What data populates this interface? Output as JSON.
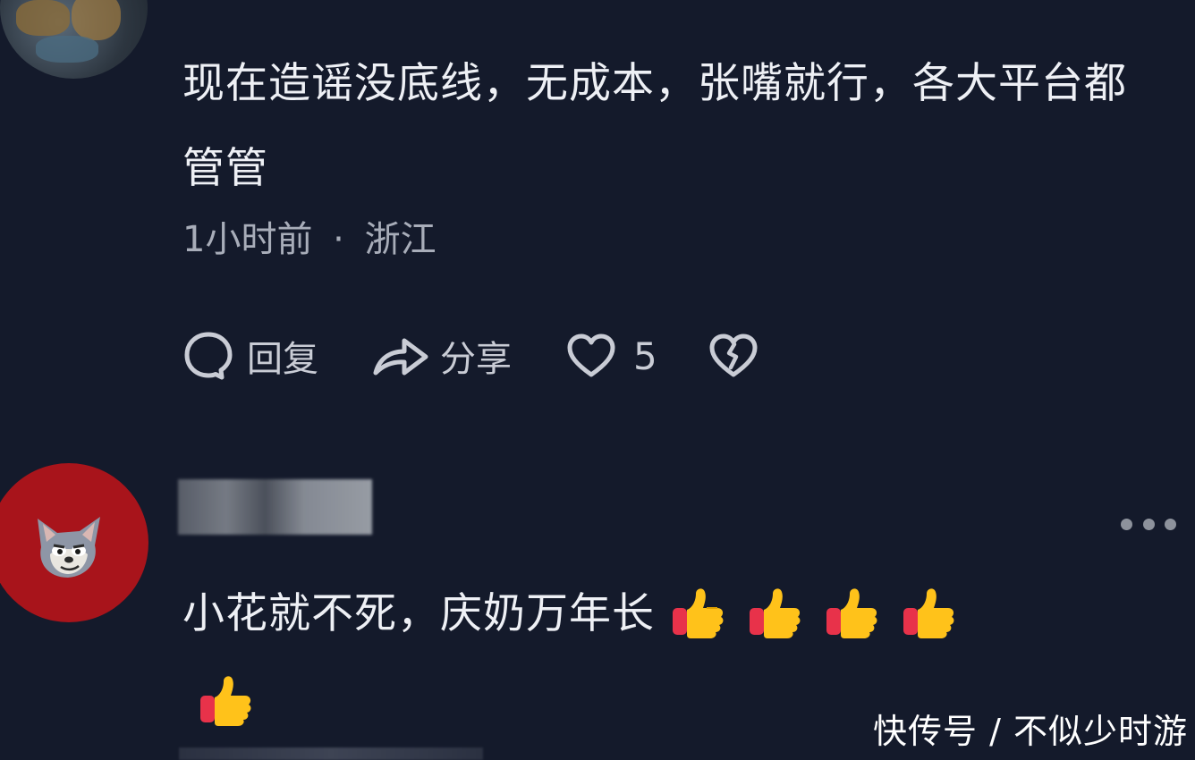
{
  "comment1": {
    "text": "现在造谣没底线，无成本，张嘴就行，各大平台都管管",
    "time": "1小时前",
    "separator": "·",
    "location": "浙江"
  },
  "actions": {
    "reply_label": "回复",
    "share_label": "分享",
    "like_count": "5",
    "icons": [
      "comment-icon",
      "share-icon",
      "heart-icon",
      "broken-heart-icon"
    ]
  },
  "comment2": {
    "text": "小花就不死，庆奶万年长",
    "emoji": "thumbs-up",
    "emoji_count": 5
  },
  "watermark": "快传号 / 不似少时游",
  "colors": {
    "background": "#141a2b",
    "text": "#eef0f5",
    "meta": "#a8adb9",
    "avatar2_bg": "#a8141b"
  }
}
